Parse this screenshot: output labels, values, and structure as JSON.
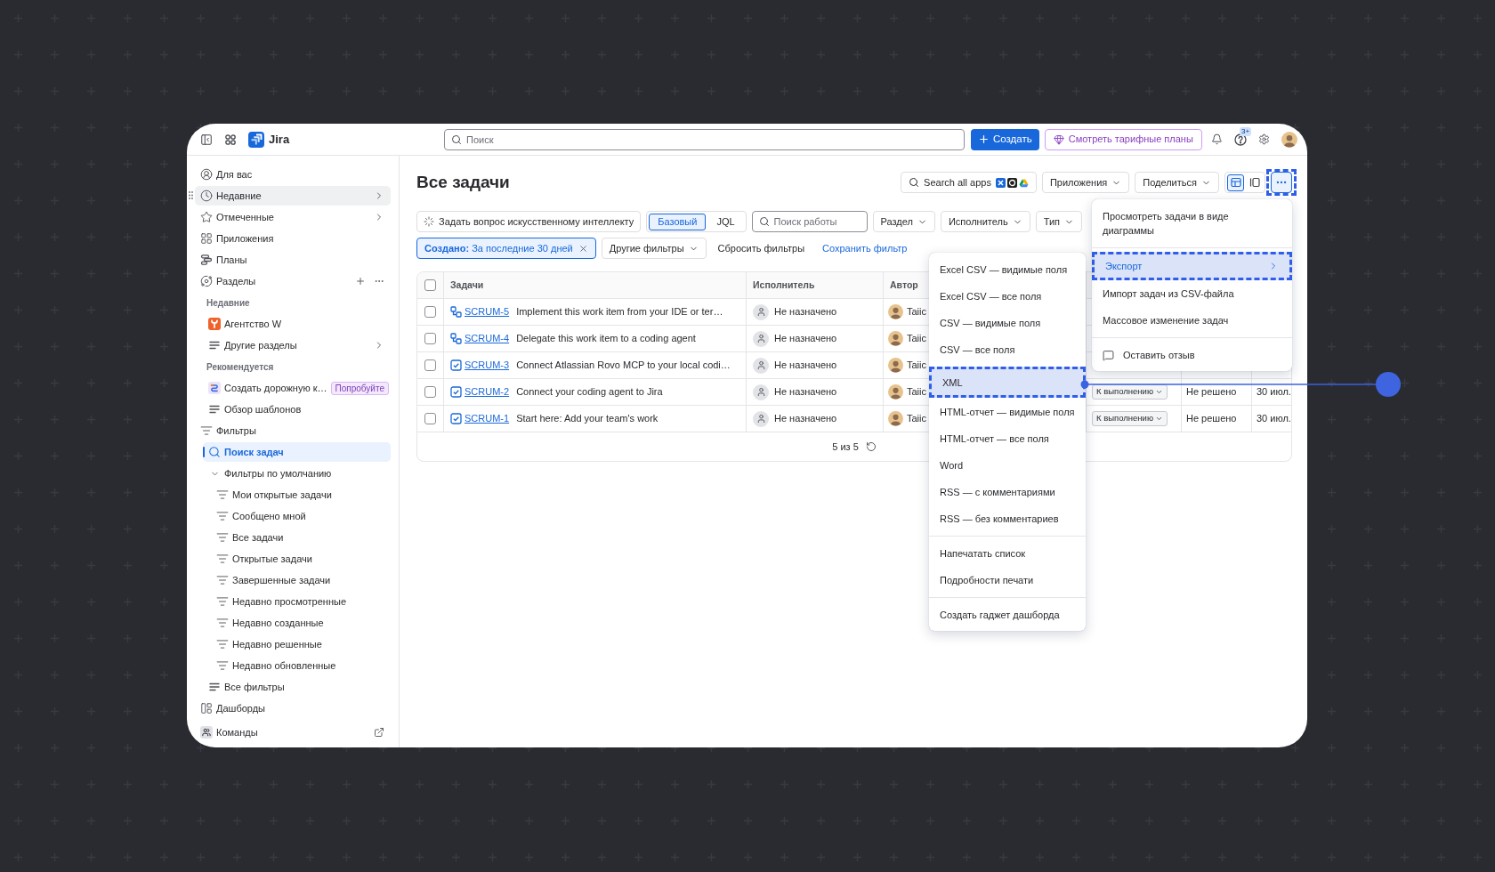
{
  "topbar": {
    "product": "Jira",
    "search": {
      "placeholder": "Поиск"
    },
    "create_button": "Создать",
    "plans_button": "Смотреть тарифные планы",
    "notifications_badge": "3+"
  },
  "sidebar": {
    "items": [
      {
        "label": "Для вас",
        "selected": false,
        "hovered": false
      },
      {
        "label": "Недавние",
        "selected": false,
        "hovered": true
      },
      {
        "label": "Отмеченные",
        "selected": false,
        "hovered": false
      },
      {
        "label": "Приложения",
        "selected": false,
        "hovered": false
      },
      {
        "label": "Планы",
        "selected": false,
        "hovered": false
      },
      {
        "label": "Разделы",
        "selected": false,
        "hovered": false,
        "children": [
          {
            "kind": "label",
            "label": "Недавние"
          },
          {
            "kind": "item",
            "label": "Агентство W",
            "selected": false,
            "hovered": false
          },
          {
            "kind": "item",
            "label": "Другие разделы",
            "selected": false,
            "hovered": false
          },
          {
            "kind": "label",
            "label": "Рекомендуется"
          },
          {
            "kind": "item",
            "label": "Создать дорожную к…",
            "badge": "Попробуйте",
            "selected": false,
            "hovered": false
          },
          {
            "kind": "item",
            "label": "Обзор шаблонов",
            "selected": false,
            "hovered": false
          }
        ]
      },
      {
        "label": "Фильтры",
        "selected": false,
        "hovered": false,
        "children": [
          {
            "label": "Поиск задач",
            "selected": true,
            "hovered": false
          },
          {
            "label": "Фильтры по умолчанию",
            "selected": false,
            "hovered": false,
            "expanded": true,
            "children": [
              {
                "label": "Мои открытые задачи",
                "selected": false,
                "hovered": false
              },
              {
                "label": "Сообщено мной",
                "selected": false,
                "hovered": false
              },
              {
                "label": "Все задачи",
                "selected": false,
                "hovered": false
              },
              {
                "label": "Открытые задачи",
                "selected": false,
                "hovered": false
              },
              {
                "label": "Завершенные задачи",
                "selected": false,
                "hovered": false
              },
              {
                "label": "Недавно просмотренные",
                "selected": false,
                "hovered": false
              },
              {
                "label": "Недавно созданные",
                "selected": false,
                "hovered": false
              },
              {
                "label": "Недавно решенные",
                "selected": false,
                "hovered": false
              },
              {
                "label": "Недавно обновленные",
                "selected": false,
                "hovered": false
              }
            ]
          },
          {
            "label": "Все фильтры",
            "selected": false,
            "hovered": false
          }
        ]
      },
      {
        "label": "Дашборды",
        "selected": false,
        "hovered": false
      },
      {
        "label": "Команды",
        "selected": false,
        "hovered": false
      }
    ]
  },
  "page": {
    "title": "Все задачи",
    "search_apps": "Search all apps",
    "apps_button": "Приложения",
    "share_button": "Поделиться",
    "views": [
      {
        "selected": true
      },
      {
        "selected": false
      }
    ],
    "more_button": {
      "selected": true
    }
  },
  "filters": {
    "ai_button": "Задать вопрос искусственному интеллекту",
    "modes": [
      {
        "label": "Базовый",
        "selected": true
      },
      {
        "label": "JQL",
        "selected": false
      }
    ],
    "search": {
      "placeholder": "Поиск работы"
    },
    "dropdowns": [
      "Раздел",
      "Исполнитель",
      "Тип"
    ],
    "active_filter": "**Создано:** За последние 30 дней",
    "more_filters": "Другие фильтры",
    "reset": "Сбросить фильтры",
    "save": "Сохранить фильтр"
  },
  "table": {
    "all_checked": false,
    "columns": [
      "Задачи",
      "Исполнитель",
      "Автор"
    ],
    "rows": [
      {
        "checked": false,
        "kind": "subtask",
        "key": "SCRUM-5",
        "summary": "Implement this work item from your IDE or ter…",
        "assignee": "Не назначено",
        "author": "Taiic"
      },
      {
        "checked": false,
        "kind": "subtask",
        "key": "SCRUM-4",
        "summary": "Delegate this work item to a coding agent",
        "assignee": "Не назначено",
        "author": "Taiic"
      },
      {
        "checked": false,
        "kind": "task",
        "key": "SCRUM-3",
        "summary": "Connect Atlassian Rovo MCP to your local codi…",
        "assignee": "Не назначено",
        "author": "Taiic"
      },
      {
        "checked": false,
        "kind": "task",
        "key": "SCRUM-2",
        "summary": "Connect your coding agent to Jira",
        "assignee": "Не назначено",
        "author": "Taiic",
        "column_5": "К выполнению",
        "column_6": "Не решено",
        "column_7": "30 июл."
      },
      {
        "checked": false,
        "kind": "task",
        "key": "SCRUM-1",
        "summary": "Start here: Add your team's work",
        "assignee": "Не назначено",
        "author": "Taiic",
        "column_5": "К выполнению",
        "column_6": "Не решено",
        "column_7": "30 июл."
      }
    ],
    "footer": "5 из 5"
  },
  "more_menu": {
    "groups": [
      [
        {
          "kind": "item",
          "label": "Просмотреть задачи в виде диаграммы",
          "selected": false
        }
      ],
      [
        {
          "kind": "submenu",
          "label": "Экспорт",
          "selected": true
        },
        {
          "kind": "item",
          "label": "Импорт задач из CSV-файла",
          "selected": false
        },
        {
          "kind": "item",
          "label": "Массовое изменение задач",
          "selected": false
        }
      ],
      [
        {
          "kind": "feedback",
          "label": "Оставить отзыв",
          "selected": false
        }
      ]
    ]
  },
  "export_menu": {
    "groups": [
      [
        {
          "kind": "item",
          "label": "Excel CSV — видимые поля",
          "selected": false
        },
        {
          "kind": "item",
          "label": "Excel CSV — все поля",
          "selected": false
        },
        {
          "kind": "item",
          "label": "CSV — видимые поля",
          "selected": false
        },
        {
          "kind": "item",
          "label": "CSV — все поля",
          "selected": false
        },
        {
          "kind": "item",
          "label": "XML",
          "selected": true
        },
        {
          "kind": "item",
          "label": "HTML-отчет — видимые поля",
          "selected": false
        },
        {
          "kind": "item",
          "label": "HTML-отчет — все поля",
          "selected": false
        },
        {
          "kind": "item",
          "label": "Word",
          "selected": false
        },
        {
          "kind": "item",
          "label": "RSS — с комментариями",
          "selected": false
        },
        {
          "kind": "item",
          "label": "RSS — без комментариев",
          "selected": false
        }
      ],
      [
        {
          "kind": "item",
          "label": "Напечатать список",
          "selected": false
        },
        {
          "kind": "item",
          "label": "Подробности печати",
          "selected": false
        }
      ],
      [
        {
          "kind": "item",
          "label": "Создать гаджет дашборда",
          "selected": false
        }
      ]
    ]
  }
}
